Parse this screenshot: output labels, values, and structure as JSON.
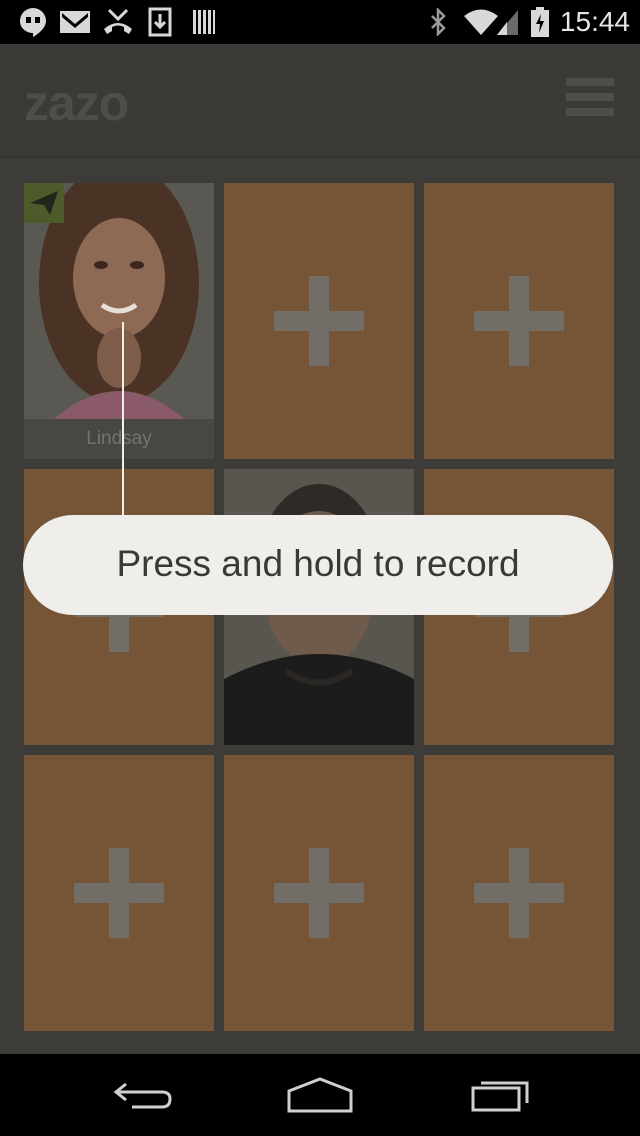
{
  "status_bar": {
    "time": "15:44",
    "left_icons": [
      "hangouts-icon",
      "gmail-icon",
      "missed-call-icon",
      "download-icon",
      "barcode-icon"
    ],
    "right_icons": [
      "bluetooth-icon",
      "wifi-icon",
      "signal-icon",
      "battery-charging-icon"
    ]
  },
  "app": {
    "logo_text": "zazo"
  },
  "grid": {
    "friend_name": "Lindsay"
  },
  "tooltip": {
    "text": "Press and hold to record"
  },
  "nav_bar": {
    "buttons": [
      "back",
      "home",
      "recents"
    ]
  }
}
